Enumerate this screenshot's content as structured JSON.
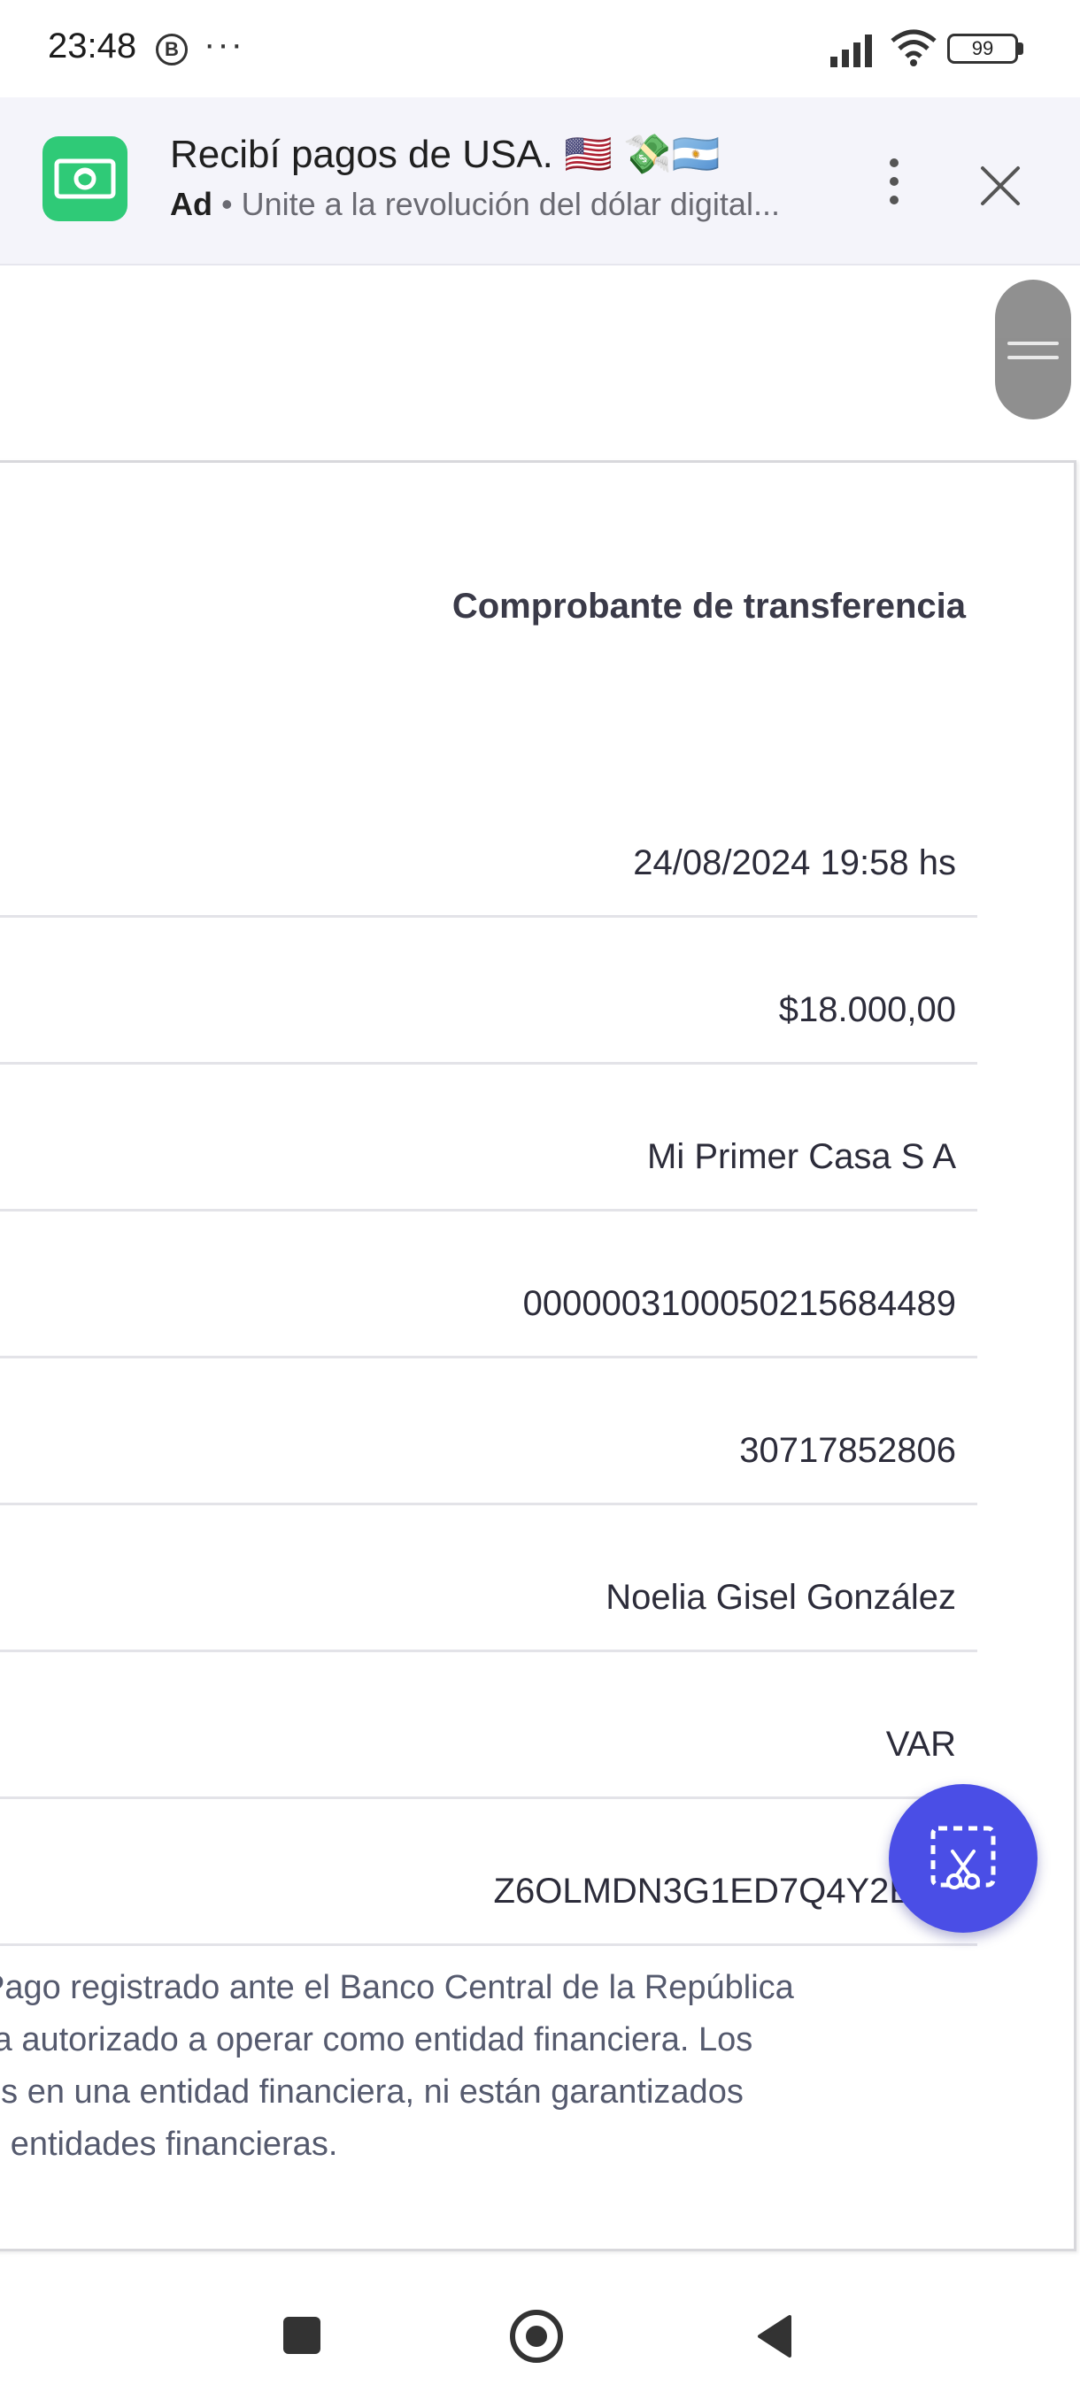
{
  "status_bar": {
    "time": "23:48",
    "notification_icon": "B",
    "overflow": "···",
    "battery": "99",
    "icons": [
      "signal-icon",
      "wifi-icon",
      "battery-icon"
    ]
  },
  "ad": {
    "title": "Recibí pagos de USA. 🇺🇸 💸🇦🇷",
    "badge": "Ad",
    "separator": " • ",
    "text": "Unite a la revolución del dólar digital...",
    "app_icon": "money-bill-icon",
    "accent_color": "#2fca77"
  },
  "receipt": {
    "title": "Comprobante de transferencia",
    "rows": [
      {
        "value": "24/08/2024 19:58 hs"
      },
      {
        "value": "$18.000,00"
      },
      {
        "value": "Mi Primer Casa S A"
      },
      {
        "value": "0000003100050215684489"
      },
      {
        "value": "30717852806"
      },
      {
        "value": "Noelia Gisel González"
      },
      {
        "value": "VAR"
      },
      {
        "value": "Z6OLMDN3G1ED7Q4Y2E7P"
      }
    ],
    "disclaimer_lines": [
      "Pago registrado ante el Banco Central de la República",
      "ra autorizado a operar como entidad financiera. Los",
      "os en una entidad financiera, ni están garantizados",
      "n entidades financieras."
    ]
  },
  "fab": {
    "icon": "screenshot-scissors-icon",
    "color": "#4a4ee6"
  },
  "nav": {
    "icons": [
      "recents-icon",
      "home-icon",
      "back-icon"
    ]
  }
}
